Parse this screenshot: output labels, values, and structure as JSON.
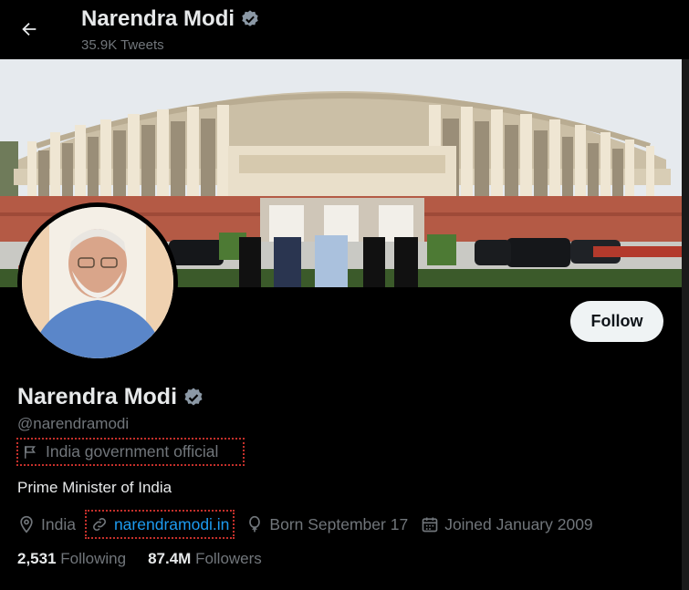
{
  "header": {
    "name": "Narendra Modi",
    "tweet_count": "35.9K Tweets"
  },
  "profile": {
    "name": "Narendra Modi",
    "handle": "@narendramodi",
    "affiliation": "India government official",
    "bio": "Prime Minister of India",
    "location": "India",
    "website": "narendramodi.in",
    "birthday": "Born September 17",
    "joined": "Joined January 2009"
  },
  "stats": {
    "following_count": "2,531",
    "following_label": "Following",
    "followers_count": "87.4M",
    "followers_label": "Followers"
  },
  "actions": {
    "follow_label": "Follow"
  },
  "colors": {
    "background": "#000000",
    "verified": "#8b98a5",
    "link": "#1d9bf0",
    "secondary_text": "#71767b"
  },
  "icons": [
    "back-arrow-icon",
    "verified-badge-icon",
    "flag-icon",
    "location-pin-icon",
    "link-icon",
    "balloon-icon",
    "calendar-icon"
  ]
}
